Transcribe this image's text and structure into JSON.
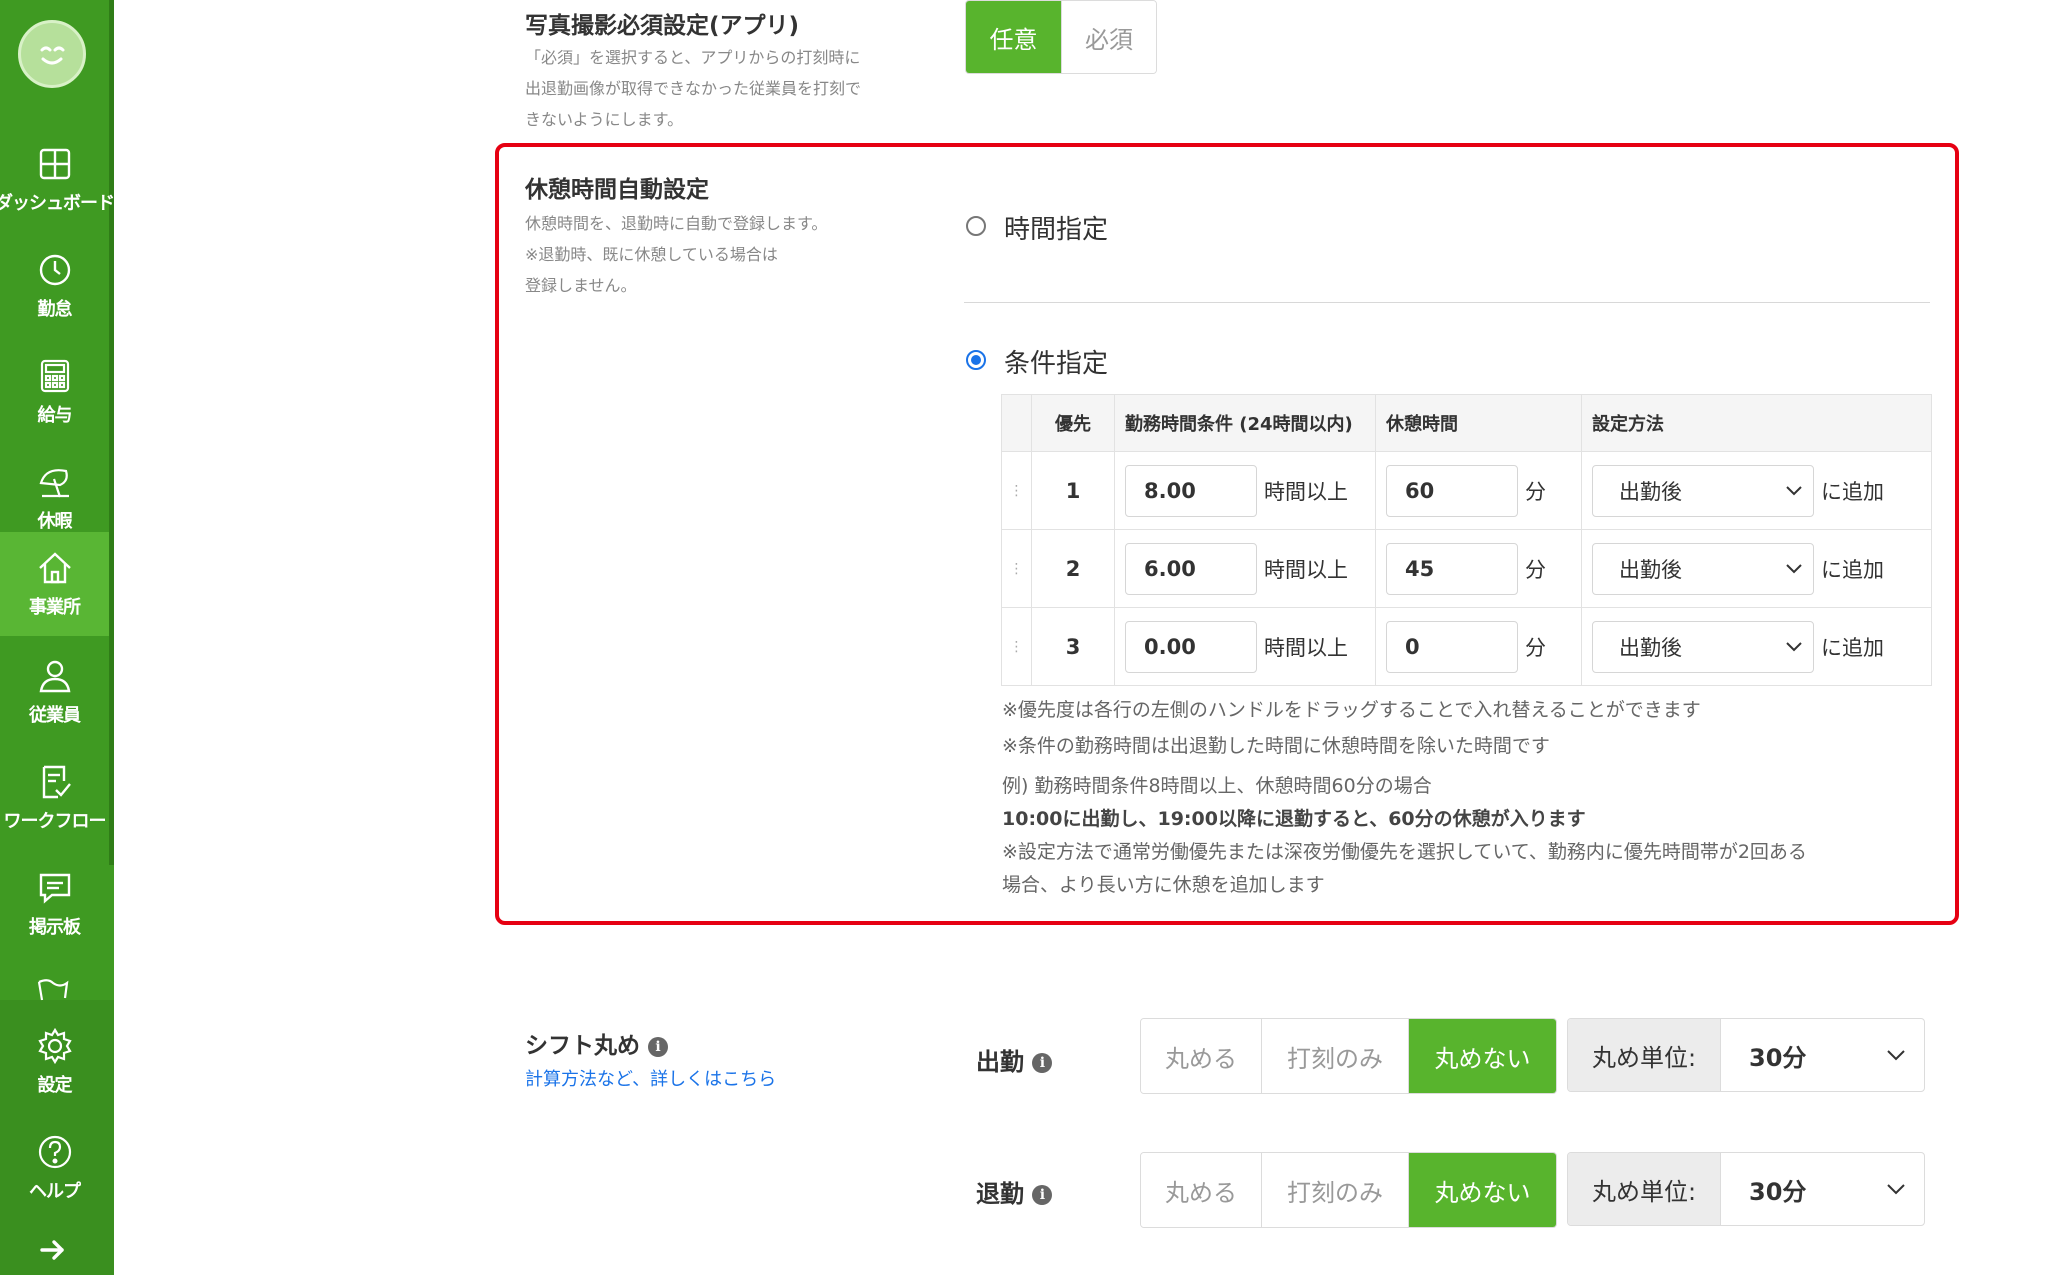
{
  "sidebar": {
    "items": [
      {
        "label": "ダッシュボード",
        "icon": "dashboard-icon"
      },
      {
        "label": "勤怠",
        "icon": "clock-icon"
      },
      {
        "label": "給与",
        "icon": "calculator-icon"
      },
      {
        "label": "休暇",
        "icon": "umbrella-icon"
      },
      {
        "label": "事業所",
        "icon": "home-icon",
        "active": true
      },
      {
        "label": "従業員",
        "icon": "person-icon"
      },
      {
        "label": "ワークフロー",
        "icon": "checklist-icon"
      },
      {
        "label": "掲示板",
        "icon": "chat-icon"
      },
      {
        "label": "設定",
        "icon": "gear-icon"
      },
      {
        "label": "ヘルプ",
        "icon": "help-icon"
      }
    ],
    "accent_color": "#3f9a22",
    "active_color": "#59b634"
  },
  "photo_setting": {
    "title": "写真撮影必須設定(アプリ)",
    "desc_lines": [
      "「必須」を選択すると、アプリからの打刻時に",
      "出退勤画像が取得できなかった従業員を打刻で",
      "きないようにします。"
    ],
    "options": [
      "任意",
      "必須"
    ],
    "selected": "任意"
  },
  "break_setting": {
    "title": "休憩時間自動設定",
    "desc_lines": [
      "休憩時間を、退勤時に自動で登録します。",
      "※退勤時、既に休憩している場合は",
      "登録しません。"
    ],
    "radio_time": "時間指定",
    "radio_condition": "条件指定",
    "selected": "条件指定",
    "table": {
      "headers": {
        "priority": "優先",
        "work_condition": "勤務時間条件 (24時間以内)",
        "break_time": "休憩時間",
        "method": "設定方法"
      },
      "rows": [
        {
          "priority": "1",
          "hours": "8.00",
          "hours_unit": "時間以上",
          "minutes": "60",
          "minutes_unit": "分",
          "method": "出勤後",
          "method_suffix": "に追加"
        },
        {
          "priority": "2",
          "hours": "6.00",
          "hours_unit": "時間以上",
          "minutes": "45",
          "minutes_unit": "分",
          "method": "出勤後",
          "method_suffix": "に追加"
        },
        {
          "priority": "3",
          "hours": "0.00",
          "hours_unit": "時間以上",
          "minutes": "0",
          "minutes_unit": "分",
          "method": "出勤後",
          "method_suffix": "に追加"
        }
      ]
    },
    "notes": {
      "n1": "※優先度は各行の左側のハンドルをドラッグすることで入れ替えることができます",
      "n2": "※条件の勤務時間は出退勤した時間に休憩時間を除いた時間です",
      "ex1": "例) 勤務時間条件8時間以上、休憩時間60分の場合",
      "ex2": "10:00に出勤し、19:00以降に退勤すると、60分の休憩が入ります",
      "n3": "※設定方法で通常労働優先または深夜労働優先を選択していて、勤務内に優先時間帯が2回ある",
      "n4": "場合、より長い方に休憩を追加します"
    }
  },
  "shift_rounding": {
    "title": "シフト丸め",
    "link": "計算方法など、詳しくはこちら",
    "rows": [
      {
        "label": "出勤",
        "options": [
          "丸める",
          "打刻のみ",
          "丸めない"
        ],
        "selected": "丸めない",
        "unit_label": "丸め単位:",
        "unit_value": "30分"
      },
      {
        "label": "退勤",
        "options": [
          "丸める",
          "打刻のみ",
          "丸めない"
        ],
        "selected": "丸めない",
        "unit_label": "丸め単位:",
        "unit_value": "30分"
      }
    ]
  }
}
